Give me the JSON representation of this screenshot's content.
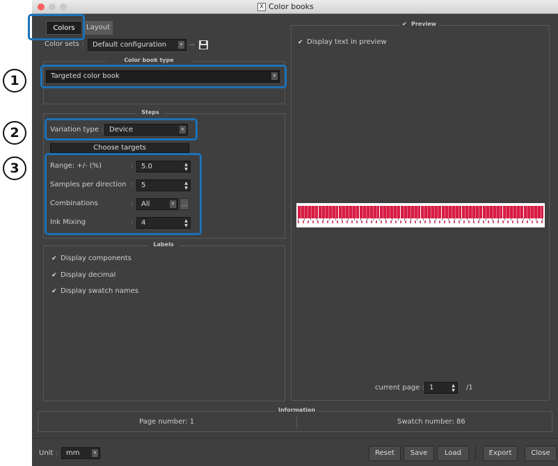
{
  "window": {
    "title": "Color books",
    "app_icon": "x-app-icon"
  },
  "tabs": [
    {
      "label": "Colors"
    },
    {
      "label": "Layout"
    }
  ],
  "color_sets": {
    "label": "Color sets",
    "value": "Default configuration",
    "more_label": "..."
  },
  "color_book_type": {
    "section": "Color book type",
    "value": "Targeted color book"
  },
  "steps": {
    "section": "Steps",
    "variation_type_label": "Variation type",
    "variation_type_value": "Device",
    "choose_targets_label": "Choose targets",
    "rows": [
      {
        "label": "Range: +/- (%)",
        "value": "5.0"
      },
      {
        "label": "Samples per direction",
        "value": "5"
      },
      {
        "label": "Combinations",
        "value": "All"
      },
      {
        "label": "Ink Mixing",
        "value": "4"
      }
    ]
  },
  "labels": {
    "section": "Labels",
    "items": [
      {
        "label": "Display components"
      },
      {
        "label": "Display decimal"
      },
      {
        "label": "Display swatch names"
      }
    ]
  },
  "preview": {
    "section": "Preview",
    "display_text_label": "Display text in preview",
    "current_page_label": "current page",
    "current_page_value": "1",
    "total_pages": "/1"
  },
  "information": {
    "section": "Information",
    "page_number": "Page number: 1",
    "swatch_number": "Swatch number: 86"
  },
  "footer": {
    "unit_label": "Unit",
    "unit_value": "mm",
    "buttons": {
      "reset": "Reset",
      "save": "Save",
      "load": "Load",
      "export": "Export",
      "close": "Close"
    }
  },
  "callouts": [
    "1",
    "2",
    "3"
  ],
  "colors": {
    "accent_highlight": "#1c72b8",
    "swatch_red": "#d81c44",
    "panel_bg": "#3f3f3f"
  }
}
